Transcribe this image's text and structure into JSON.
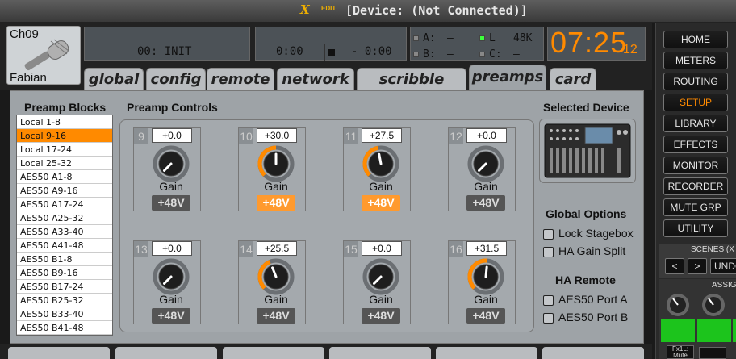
{
  "window": {
    "logo": "X",
    "logo_edit": "EDIT",
    "title": "[Device: (Not Connected)]"
  },
  "channel": {
    "id": "Ch09",
    "name": "Fabian",
    "icon": "microphone-icon"
  },
  "lcd": {
    "scene": "00: INIT",
    "time_elapsed": "0:00",
    "time_remaining": "- 0:00",
    "meters": [
      {
        "label": "A:",
        "value": "–",
        "led_on": false
      },
      {
        "label": "B:",
        "value": "–",
        "led_on": false
      },
      {
        "label": "L",
        "value": "48K",
        "led_on": true
      },
      {
        "label": "C:",
        "value": "–",
        "led_on": false
      }
    ]
  },
  "clock": {
    "main": "07:25",
    "seconds": "12",
    "color": "#ff8a00"
  },
  "tabs": [
    {
      "label": "global",
      "active": false
    },
    {
      "label": "config",
      "active": false
    },
    {
      "label": "remote",
      "active": false
    },
    {
      "label": "network",
      "active": false
    },
    {
      "label": "scribble strip",
      "active": false
    },
    {
      "label": "preamps",
      "active": true
    },
    {
      "label": "card",
      "active": false
    }
  ],
  "preamp_blocks": {
    "header": "Preamp Blocks",
    "items": [
      "Local 1-8",
      "Local 9-16",
      "Local 17-24",
      "Local 25-32",
      "AES50 A1-8",
      "AES50 A9-16",
      "AES50 A17-24",
      "AES50 A25-32",
      "AES50 A33-40",
      "AES50 A41-48",
      "AES50 B1-8",
      "AES50 B9-16",
      "AES50 B17-24",
      "AES50 B25-32",
      "AES50 B33-40",
      "AES50 B41-48"
    ],
    "selected_index": 1
  },
  "preamp_controls": {
    "header": "Preamp Controls",
    "gain_label": "Gain",
    "phantom_label": "+48V",
    "channels": [
      {
        "num": "9",
        "gain": "+0.0",
        "phantom": false,
        "knob_level": 0.0
      },
      {
        "num": "10",
        "gain": "+30.0",
        "phantom": true,
        "knob_level": 0.5
      },
      {
        "num": "11",
        "gain": "+27.5",
        "phantom": true,
        "knob_level": 0.46
      },
      {
        "num": "12",
        "gain": "+0.0",
        "phantom": false,
        "knob_level": 0.0
      },
      {
        "num": "13",
        "gain": "+0.0",
        "phantom": false,
        "knob_level": 0.0
      },
      {
        "num": "14",
        "gain": "+25.5",
        "phantom": false,
        "knob_level": 0.42
      },
      {
        "num": "15",
        "gain": "+0.0",
        "phantom": false,
        "knob_level": 0.0
      },
      {
        "num": "16",
        "gain": "+31.5",
        "phantom": false,
        "knob_level": 0.52
      }
    ]
  },
  "selected_device": {
    "header": "Selected Device"
  },
  "global_options": {
    "header": "Global Options",
    "items": [
      {
        "label": "Lock Stagebox",
        "checked": false
      },
      {
        "label": "HA Gain Split",
        "checked": false
      }
    ]
  },
  "ha_remote": {
    "header": "HA Remote",
    "items": [
      {
        "label": "AES50 Port A",
        "checked": false
      },
      {
        "label": "AES50 Port B",
        "checked": false
      }
    ]
  },
  "sidebar": {
    "buttons": [
      {
        "label": "HOME",
        "active": false
      },
      {
        "label": "METERS",
        "active": false
      },
      {
        "label": "ROUTING",
        "active": false
      },
      {
        "label": "SETUP",
        "active": true
      },
      {
        "label": "LIBRARY",
        "active": false
      },
      {
        "label": "EFFECTS",
        "active": false
      },
      {
        "label": "MONITOR",
        "active": false
      },
      {
        "label": "RECORDER",
        "active": false
      },
      {
        "label": "MUTE GRP",
        "active": false
      },
      {
        "label": "UTILITY",
        "active": false
      }
    ],
    "scenes_label": "SCENES (X",
    "scene_prev": "<",
    "scene_next": ">",
    "scene_undo": "UNDO",
    "assign_label": "ASSIG",
    "fx_label": "Fx1L: Mute"
  },
  "colors": {
    "accent": "#ff8a00",
    "phantom_on": "#ff9a2e",
    "green": "#1cc41c"
  }
}
